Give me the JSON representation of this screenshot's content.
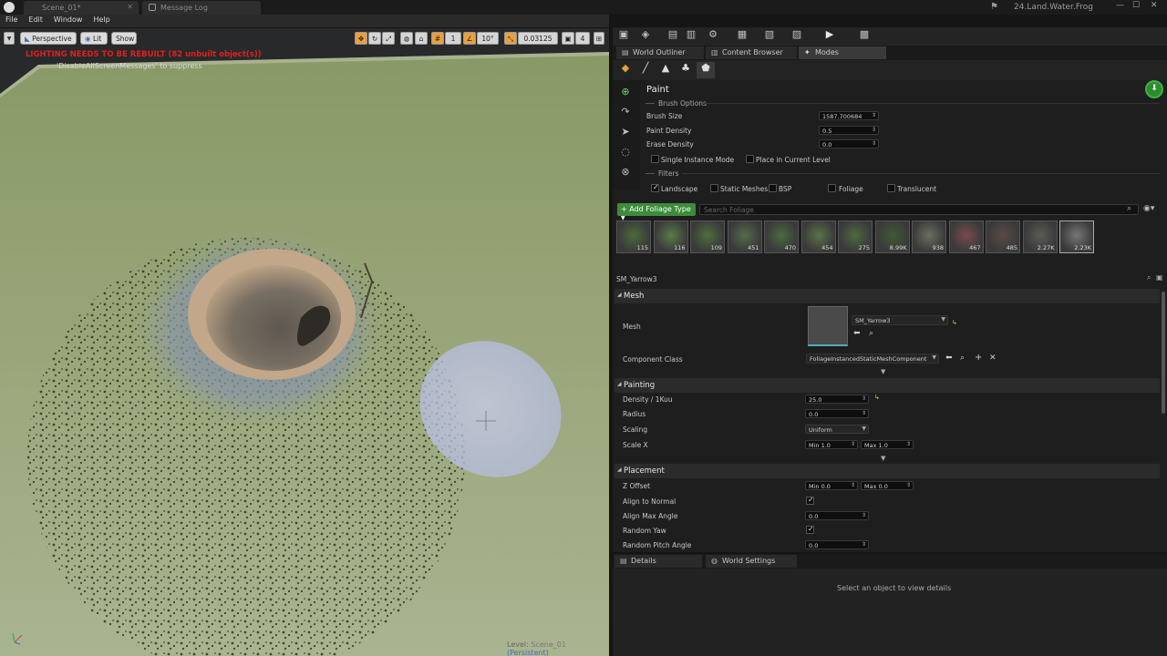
{
  "window": {
    "project": "24.Land.Water.Frog",
    "tabs": [
      {
        "label": "Scene_01*"
      },
      {
        "label": "Message Log"
      }
    ]
  },
  "menu": [
    "File",
    "Edit",
    "Window",
    "Help"
  ],
  "viewport": {
    "perspective": "Perspective",
    "lit": "Lit",
    "show": "Show",
    "warning": "LIGHTING NEEDS TO BE REBUILT (82 unbuilt object(s))",
    "suppress": "'DisableAllScreenMessages' to suppress",
    "grid_snap": "1",
    "angle_snap": "10°",
    "scale_snap": "0.03125",
    "camera_speed": "4",
    "level_prefix": "Level:",
    "level_name": "Scene_01",
    "level_suffix": "(Persistent)"
  },
  "right_tabs": {
    "outliner": "World Outliner",
    "content": "Content Browser",
    "modes": "Modes"
  },
  "paint": {
    "title": "Paint",
    "brush_options": "Brush Options",
    "brush_size_label": "Brush Size",
    "brush_size": "1587.700684",
    "paint_density_label": "Paint Density",
    "paint_density": "0.5",
    "erase_density_label": "Erase Density",
    "erase_density": "0.0",
    "single_instance": "Single Instance Mode",
    "place_current": "Place in Current Level",
    "filters": "Filters",
    "f_landscape": "Landscape",
    "f_static": "Static Meshes",
    "f_bsp": "BSP",
    "f_foliage": "Foliage",
    "f_translucent": "Translucent",
    "add_foliage": "Add Foliage Type",
    "search_placeholder": "Search Foliage",
    "thumbs": [
      "115",
      "116",
      "109",
      "451",
      "470",
      "454",
      "275",
      "8.99K",
      "938",
      "467",
      "485",
      "2.27K",
      "2.23K"
    ]
  },
  "details": {
    "selected": "SM_Yarrow3",
    "mesh_cat": "Mesh",
    "mesh_label": "Mesh",
    "mesh_value": "SM_Yarrow3",
    "comp_class_label": "Component Class",
    "comp_class_value": "FoliageInstancedStaticMeshComponent",
    "painting_cat": "Painting",
    "density_label": "Density / 1Kuu",
    "density": "25.0",
    "radius_label": "Radius",
    "radius": "0.0",
    "scaling_label": "Scaling",
    "scaling": "Uniform",
    "scalex_label": "Scale X",
    "scalex_min": "Min  1.0",
    "scalex_max": "Max  1.0",
    "placement_cat": "Placement",
    "zoffset_label": "Z Offset",
    "zoffset_min": "Min  0.0",
    "zoffset_max": "Max  0.0",
    "align_normal_label": "Align to Normal",
    "align_max_label": "Align Max Angle",
    "align_max": "0.0",
    "random_yaw_label": "Random Yaw",
    "random_pitch_label": "Random Pitch Angle",
    "random_pitch": "0.0"
  },
  "bottom": {
    "details_tab": "Details",
    "world_tab": "World Settings",
    "empty": "Select an object to view details"
  }
}
